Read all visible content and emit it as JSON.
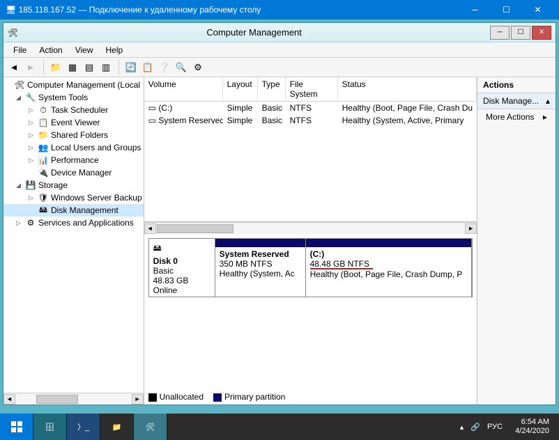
{
  "rdp": {
    "title": "185.118.167.52 — Подключение к удаленному рабочему столу"
  },
  "mmc": {
    "title": "Computer Management",
    "menu": {
      "file": "File",
      "action": "Action",
      "view": "View",
      "help": "Help"
    }
  },
  "tree": {
    "root": "Computer Management (Local",
    "system_tools": "System Tools",
    "task_scheduler": "Task Scheduler",
    "event_viewer": "Event Viewer",
    "shared_folders": "Shared Folders",
    "local_users": "Local Users and Groups",
    "performance": "Performance",
    "device_manager": "Device Manager",
    "storage": "Storage",
    "wsb": "Windows Server Backup",
    "disk_mgmt": "Disk Management",
    "services": "Services and Applications"
  },
  "cols": {
    "volume": "Volume",
    "layout": "Layout",
    "type": "Type",
    "fs": "File System",
    "status": "Status"
  },
  "vols": [
    {
      "name": "(C:)",
      "layout": "Simple",
      "type": "Basic",
      "fs": "NTFS",
      "status": "Healthy (Boot, Page File, Crash Du"
    },
    {
      "name": "System Reserved",
      "layout": "Simple",
      "type": "Basic",
      "fs": "NTFS",
      "status": "Healthy (System, Active, Primary"
    }
  ],
  "disk": {
    "label": "Disk 0",
    "type": "Basic",
    "size": "48.83 GB",
    "state": "Online",
    "p1": {
      "name": "System Reserved",
      "info": "350 MB NTFS",
      "status": "Healthy (System, Ac"
    },
    "p2": {
      "name": "(C:)",
      "info": "48.48 GB NTFS",
      "status": "Healthy (Boot, Page File, Crash Dump, P"
    }
  },
  "legend": {
    "unalloc": "Unallocated",
    "primary": "Primary partition"
  },
  "actions": {
    "header": "Actions",
    "section": "Disk Manage...",
    "more": "More Actions"
  },
  "tray": {
    "lang": "РУС",
    "time": "6:54 AM",
    "date": "4/24/2020"
  }
}
